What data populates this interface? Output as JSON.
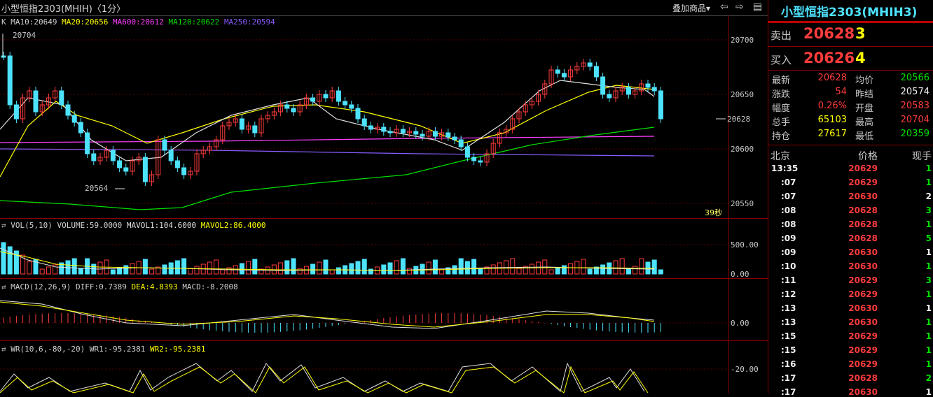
{
  "header": {
    "title": "小型恒指2303(MHIH)〈1分〉",
    "overlay_btn": "叠加商品▾",
    "icons": [
      "arrow-left-icon",
      "arrow-right-icon",
      "window-icon"
    ]
  },
  "main_legend": {
    "k": "K",
    "ma10": "MA10:20649",
    "ma20": "MA20:20656",
    "ma600": "MA600:20612",
    "ma120": "MA120:20622",
    "ma250": "MA250:20594"
  },
  "main_axis": [
    "20700",
    "20650",
    "20600",
    "20550"
  ],
  "main_marks": {
    "high": "20704",
    "low": "20564",
    "last": "20628",
    "countdown": "39秒"
  },
  "vol_legend": {
    "label": "VOL(5,10)",
    "volume": "VOLUME:59.0000",
    "mavol1": "MAVOL1:104.6000",
    "mavol2": "MAVOL2:86.4000"
  },
  "vol_axis": [
    "500.00",
    "0.00"
  ],
  "macd_legend": {
    "label": "MACD(12,26,9)",
    "diff": "DIFF:0.7389",
    "dea": "DEA:4.8393",
    "macd": "MACD:-8.2008"
  },
  "macd_axis": [
    "0.00"
  ],
  "wr_legend": {
    "label": "WR(10,6,-80,-20)",
    "wr1": "WR1:-95.2381",
    "wr2": "WR2:-95.2381"
  },
  "wr_axis": [
    "-20.00"
  ],
  "quote": {
    "title": "小型恒指2303(MHIH3)",
    "ask_label": "卖出",
    "ask_price": "20628",
    "ask_qty": "3",
    "bid_label": "买入",
    "bid_price": "20626",
    "bid_qty": "4",
    "stats": [
      {
        "l1": "最新",
        "v1": "20628",
        "c1": "red",
        "l2": "均价",
        "v2": "20566",
        "c2": "green"
      },
      {
        "l1": "涨跌",
        "v1": "54",
        "c1": "red",
        "l2": "昨结",
        "v2": "20574",
        "c2": "white"
      },
      {
        "l1": "幅度",
        "v1": "0.26%",
        "c1": "red",
        "l2": "开盘",
        "v2": "20583",
        "c2": "red"
      },
      {
        "l1": "总手",
        "v1": "65103",
        "c1": "yellow",
        "l2": "最高",
        "v2": "20704",
        "c2": "red"
      },
      {
        "l1": "持仓",
        "v1": "27617",
        "c1": "yellow",
        "l2": "最低",
        "v2": "20359",
        "c2": "green"
      }
    ],
    "ticks_header": {
      "time": "北京",
      "price": "价格",
      "qty": "现手"
    },
    "ticks": [
      {
        "t": "13:35",
        "p": "20629",
        "q": "1",
        "qc": "green"
      },
      {
        "t": ":07",
        "p": "20629",
        "q": "1",
        "qc": "green"
      },
      {
        "t": ":07",
        "p": "20630",
        "q": "2",
        "qc": "white"
      },
      {
        "t": ":08",
        "p": "20628",
        "q": "3",
        "qc": "green"
      },
      {
        "t": ":08",
        "p": "20628",
        "q": "1",
        "qc": "green"
      },
      {
        "t": ":09",
        "p": "20628",
        "q": "5",
        "qc": "green"
      },
      {
        "t": ":09",
        "p": "20630",
        "q": "1",
        "qc": "white"
      },
      {
        "t": ":10",
        "p": "20630",
        "q": "1",
        "qc": "green"
      },
      {
        "t": ":11",
        "p": "20629",
        "q": "3",
        "qc": "green"
      },
      {
        "t": ":12",
        "p": "20629",
        "q": "1",
        "qc": "green"
      },
      {
        "t": ":13",
        "p": "20630",
        "q": "1",
        "qc": "white"
      },
      {
        "t": ":13",
        "p": "20630",
        "q": "1",
        "qc": "green"
      },
      {
        "t": ":15",
        "p": "20629",
        "q": "1",
        "qc": "green"
      },
      {
        "t": ":15",
        "p": "20629",
        "q": "1",
        "qc": "green"
      },
      {
        "t": ":16",
        "p": "20629",
        "q": "1",
        "qc": "green"
      },
      {
        "t": ":17",
        "p": "20628",
        "q": "2",
        "qc": "green"
      },
      {
        "t": ":17",
        "p": "20630",
        "q": "1",
        "qc": "white"
      }
    ]
  }
}
